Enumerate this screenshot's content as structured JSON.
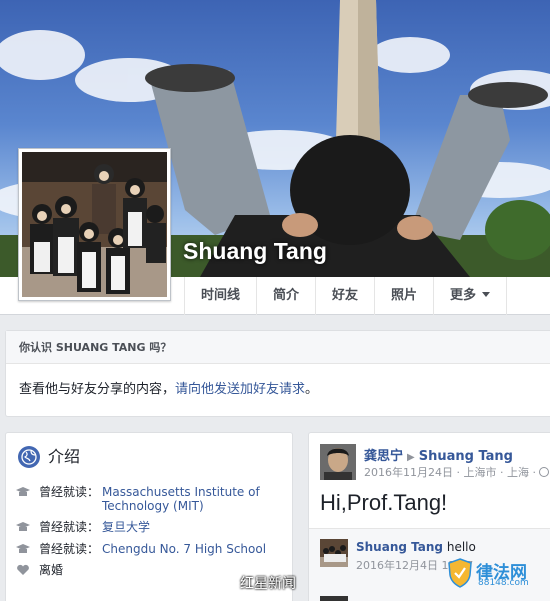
{
  "profile": {
    "name": "Shuang Tang"
  },
  "tabs": [
    {
      "label": "时间线"
    },
    {
      "label": "简介"
    },
    {
      "label": "好友"
    },
    {
      "label": "照片"
    },
    {
      "label": "更多"
    }
  ],
  "friend_prompt": {
    "heading": "你认识 SHUANG TANG 吗？",
    "text": "查看他与好友分享的内容，",
    "link": "请向他发送加好友请求",
    "end": "。"
  },
  "intro": {
    "title": "介绍",
    "rows": [
      {
        "icon": "graduation-cap-icon",
        "label": "曾经就读：",
        "value": "Massachusetts Institute of Technology (MIT)"
      },
      {
        "icon": "graduation-cap-icon",
        "label": "曾经就读：",
        "value": "复旦大学"
      },
      {
        "icon": "graduation-cap-icon",
        "label": "曾经就读：",
        "value": "Chengdu No. 7 High School"
      },
      {
        "icon": "heart-icon",
        "label": "离婚",
        "value": ""
      }
    ]
  },
  "post": {
    "author": "龚思宁",
    "target": "Shuang Tang",
    "meta": "2016年11月24日 · 上海市 · 上海 ·",
    "text": "Hi,Prof.Tang!",
    "comment": {
      "author": "Shuang Tang",
      "text": "hello",
      "meta": "2016年12月4日  17:07"
    }
  },
  "watermarks": {
    "source": "红星新闻",
    "logo_name": "律法网",
    "logo_domain": "88148.com"
  },
  "colors": {
    "link": "#365899",
    "accent": "#4267b2",
    "background": "#e9ebee"
  }
}
